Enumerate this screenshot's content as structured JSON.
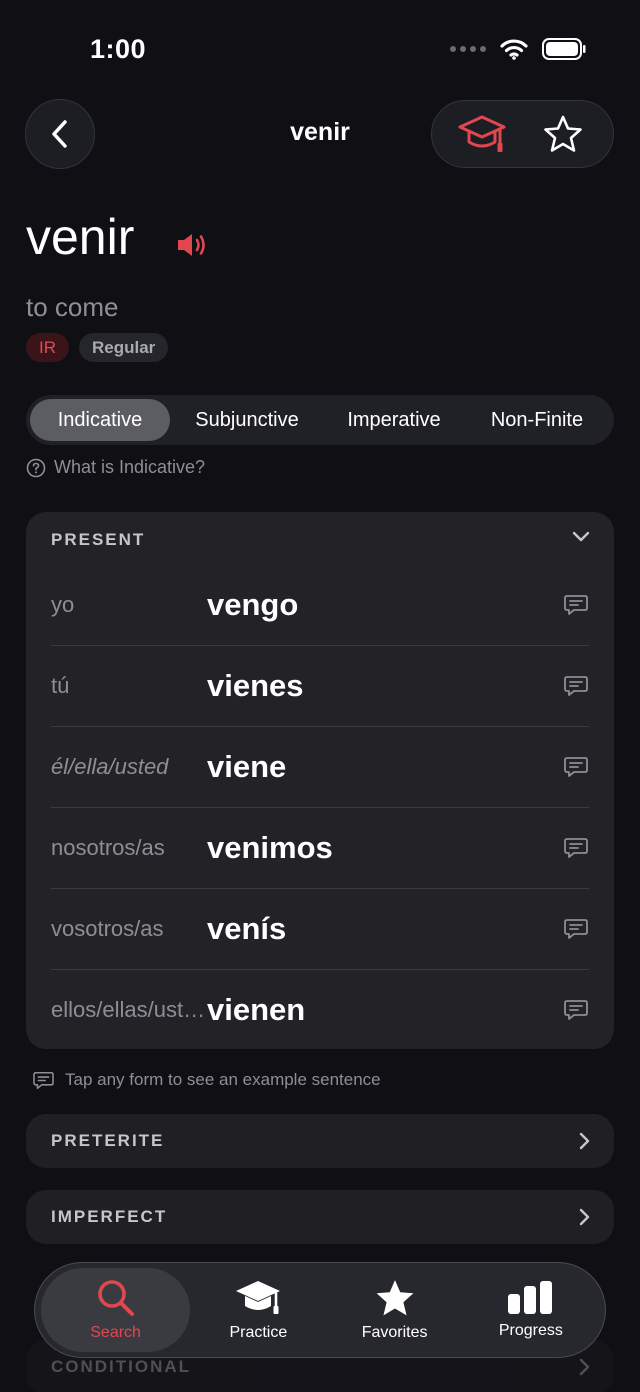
{
  "status_bar": {
    "time": "1:00"
  },
  "nav": {
    "title": "venir"
  },
  "verb": {
    "infinitive": "venir",
    "translation": "to come",
    "tags": [
      "IR",
      "Regular"
    ]
  },
  "moods": {
    "tabs": [
      "Indicative",
      "Subjunctive",
      "Imperative",
      "Non-Finite"
    ],
    "active": "Indicative",
    "help_text": "What is Indicative?"
  },
  "present": {
    "title": "PRESENT",
    "rows": [
      {
        "pronoun": "yo",
        "form": "vengo"
      },
      {
        "pronoun": "tú",
        "form": "vienes"
      },
      {
        "pronoun": "él/ella/usted",
        "form": "viene"
      },
      {
        "pronoun": "nosotros/as",
        "form": "venimos"
      },
      {
        "pronoun": "vosotros/as",
        "form": "venís"
      },
      {
        "pronoun": "ellos/ellas/ustedes",
        "form": "vienen"
      }
    ]
  },
  "hint": "Tap any form to see an example sentence",
  "sections": [
    {
      "label": "PRETERITE"
    },
    {
      "label": "IMPERFECT"
    },
    {
      "label": "CONDITIONAL"
    }
  ],
  "tabbar": {
    "items": [
      {
        "label": "Search",
        "icon": "search-icon"
      },
      {
        "label": "Practice",
        "icon": "graduation-cap-icon"
      },
      {
        "label": "Favorites",
        "icon": "star-icon"
      },
      {
        "label": "Progress",
        "icon": "bar-chart-icon"
      }
    ],
    "active": "Search"
  },
  "colors": {
    "accent": "#e0474f",
    "background": "#0f0f14",
    "card": "#232327"
  }
}
